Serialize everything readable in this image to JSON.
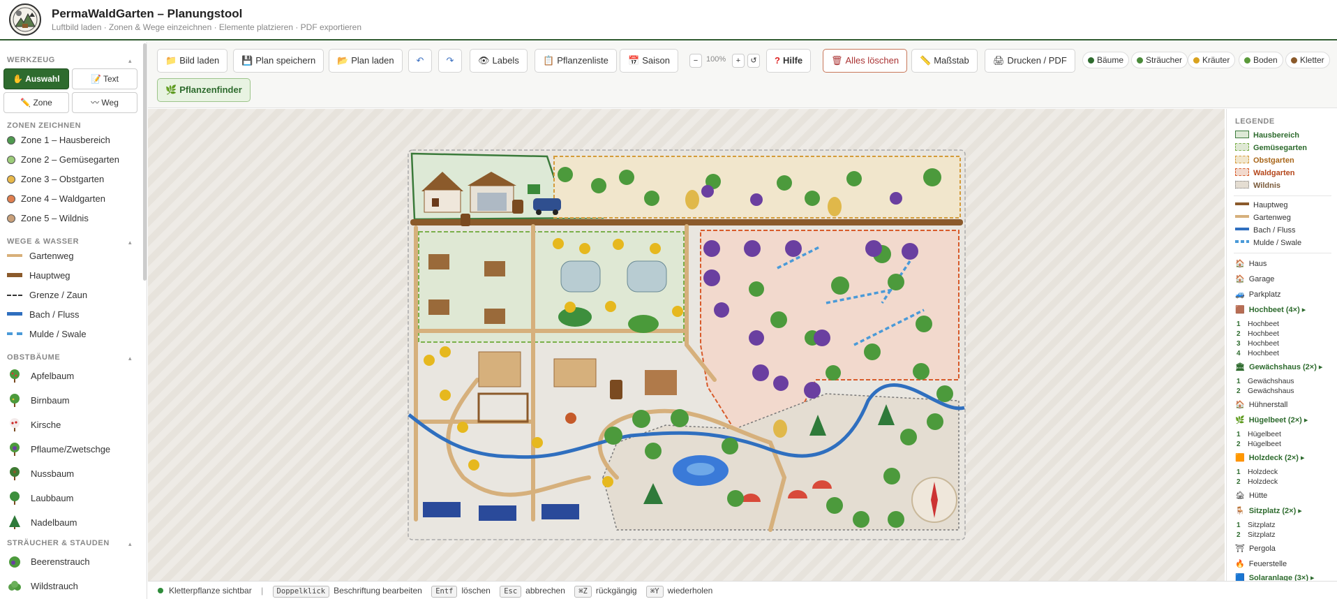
{
  "app": {
    "title": "PermaWaldGarten – Planungstool",
    "subtitle": "Luftbild laden · Zonen & Wege einzeichnen · Elemente platzieren · PDF exportieren"
  },
  "sidebar": {
    "werkzeug": {
      "title": "WERKZEUG",
      "tools": [
        {
          "label": "✋ Auswahl",
          "active": true
        },
        {
          "label": "📝 Text"
        },
        {
          "label": "✏️ Zone"
        },
        {
          "label": "〰 Weg"
        }
      ]
    },
    "zonen": {
      "title": "ZONEN ZEICHNEN",
      "items": [
        {
          "label": "Zone 1 – Hausbereich",
          "color": "#4f9a4f"
        },
        {
          "label": "Zone 2 – Gemüsegarten",
          "color": "#9ccc7a"
        },
        {
          "label": "Zone 3 – Obstgarten",
          "color": "#e8b84a"
        },
        {
          "label": "Zone 4 – Waldgarten",
          "color": "#e07f4f"
        },
        {
          "label": "Zone 5 – Wildnis",
          "color": "#c9a07a"
        }
      ]
    },
    "wege": {
      "title": "WEGE & WASSER",
      "items": [
        {
          "label": "Gartenweg",
          "color": "#d8b07a"
        },
        {
          "label": "Hauptweg",
          "color": "#8b5a2b"
        },
        {
          "label": "Grenze / Zaun",
          "color": "#333333"
        },
        {
          "label": "Bach / Fluss",
          "color": "#2f6fbf"
        },
        {
          "label": "Mulde / Swale",
          "color": "#4a9ad8"
        }
      ]
    },
    "obst": {
      "title": "OBSTBÄUME",
      "items": [
        {
          "label": "Apfelbaum",
          "icon": "apple-tree-icon"
        },
        {
          "label": "Birnbaum",
          "icon": "pear-tree-icon"
        },
        {
          "label": "Kirsche",
          "icon": "cherry-tree-icon"
        },
        {
          "label": "Pflaume/Zwetschge",
          "icon": "plum-tree-icon"
        },
        {
          "label": "Nussbaum",
          "icon": "nut-tree-icon"
        },
        {
          "label": "Laubbaum",
          "icon": "deciduous-tree-icon"
        },
        {
          "label": "Nadelbaum",
          "icon": "conifer-tree-icon"
        }
      ]
    },
    "straeucher": {
      "title": "STRÄUCHER & STAUDEN",
      "items": [
        {
          "label": "Beerenstrauch",
          "icon": "berry-bush-icon"
        },
        {
          "label": "Wildstrauch",
          "icon": "wild-shrub-icon"
        }
      ]
    }
  },
  "toolbar": {
    "bild_laden": "Bild laden",
    "plan_speichern": "Plan speichern",
    "plan_laden": "Plan laden",
    "labels": "Labels",
    "pflanzenliste": "Pflanzenliste",
    "saison": "Saison",
    "zoom": "100%",
    "hilfe": "Hilfe",
    "alles_loeschen": "Alles löschen",
    "massstab": "Maßstab",
    "drucken": "Drucken / PDF",
    "pflanzenfinder": "Pflanzenfinder",
    "filters": [
      {
        "label": "Bäume",
        "color": "#2e6b2e"
      },
      {
        "label": "Sträucher",
        "color": "#4a8a3a"
      },
      {
        "label": "Kräuter",
        "color": "#d9a21e"
      },
      {
        "label": "Boden",
        "color": "#5b9a3b"
      },
      {
        "label": "Kletter",
        "color": "#8b5a2b"
      }
    ]
  },
  "legend": {
    "title": "LEGENDE",
    "zones": [
      "Hausbereich",
      "Gemüsegarten",
      "Obstgarten",
      "Waldgarten",
      "Wildnis"
    ],
    "paths": [
      "Hauptweg",
      "Gartenweg",
      "Bach / Fluss",
      "Mulde / Swale"
    ],
    "singles_a": [
      "Haus",
      "Garage",
      "Parkplatz"
    ],
    "hochbeet": {
      "title": "Hochbeet (4×)",
      "items": [
        "Hochbeet",
        "Hochbeet",
        "Hochbeet",
        "Hochbeet"
      ]
    },
    "gewaechshaus": {
      "title": "Gewächshaus (2×)",
      "items": [
        "Gewächshaus",
        "Gewächshaus"
      ]
    },
    "huehnerstall": "Hühnerstall",
    "huegelbeet": {
      "title": "Hügelbeet (2×)",
      "items": [
        "Hügelbeet",
        "Hügelbeet"
      ]
    },
    "holzdeck": {
      "title": "Holzdeck (2×)",
      "items": [
        "Holzdeck",
        "Holzdeck"
      ]
    },
    "huette": "Hütte",
    "sitzplatz": {
      "title": "Sitzplatz (2×)",
      "items": [
        "Sitzplatz",
        "Sitzplatz"
      ]
    },
    "pergola": "Pergola",
    "feuerstelle": "Feuerstelle",
    "solar": "Solaranlage (3×)"
  },
  "status": {
    "indicator": "Kletterpflanze sichtbar",
    "sep": "|",
    "hints": [
      {
        "key": "Doppelklick",
        "text": "Beschriftung bearbeiten"
      },
      {
        "key": "Entf",
        "text": "löschen"
      },
      {
        "key": "Esc",
        "text": "abbrechen"
      },
      {
        "key": "⌘Z",
        "text": "rückgängig"
      },
      {
        "key": "⌘Y",
        "text": "wiederholen"
      }
    ]
  }
}
